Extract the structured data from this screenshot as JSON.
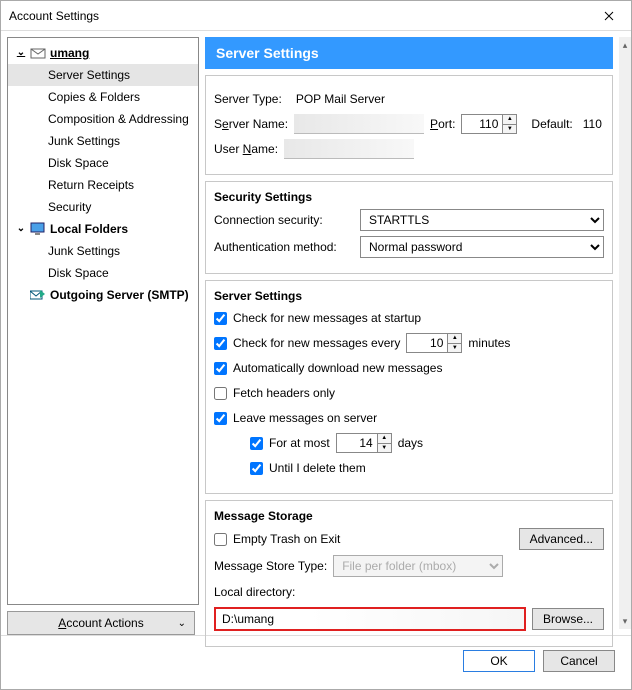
{
  "window": {
    "title": "Account Settings"
  },
  "sidebar": {
    "account_name": "umang",
    "items": [
      "Server Settings",
      "Copies & Folders",
      "Composition & Addressing",
      "Junk Settings",
      "Disk Space",
      "Return Receipts",
      "Security"
    ],
    "local_folders_label": "Local Folders",
    "local_items": [
      "Junk Settings",
      "Disk Space"
    ],
    "outgoing_label": "Outgoing Server (SMTP)",
    "account_actions": "Account Actions"
  },
  "header": {
    "title": "Server Settings"
  },
  "top": {
    "server_type_label": "Server Type:",
    "server_type_value": "POP Mail Server",
    "server_name_label_pre": "S",
    "server_name_label_under": "e",
    "server_name_label_post": "rver Name:",
    "port_label_pre": "",
    "port_label_under": "P",
    "port_label_post": "ort:",
    "port_value": "110",
    "default_label": "Default:",
    "default_value": "110",
    "user_name_label_pre": "User ",
    "user_name_label_under": "N",
    "user_name_label_post": "ame:"
  },
  "security": {
    "title": "Security Settings",
    "conn_label": "Connection security:",
    "conn_value": "STARTTLS",
    "auth_label": "Authentication method:",
    "auth_value": "Normal password"
  },
  "server": {
    "title": "Server Settings",
    "check_startup": "Check for new messages at startup",
    "check_every_pre": "Check for new messages every",
    "check_every_value": "10",
    "check_every_post": "minutes",
    "auto_download": "Automatically download new messages",
    "fetch_headers": "Fetch headers only",
    "leave_server": "Leave messages on server",
    "for_at_most_pre": "For at most",
    "for_at_most_value": "14",
    "for_at_most_post": "days",
    "until_delete": "Until I delete them"
  },
  "storage": {
    "title": "Message Storage",
    "empty_trash": "Empty Trash on Exit",
    "advanced": "Advanced...",
    "store_type_label": "Message Store Type:",
    "store_type_value": "File per folder (mbox)",
    "local_dir_label": "Local directory:",
    "local_dir_value": "D:\\umang",
    "browse": "Browse..."
  },
  "footer": {
    "ok": "OK",
    "cancel": "Cancel"
  },
  "checks": {
    "startup": true,
    "every": true,
    "auto_dl": true,
    "headers": false,
    "leave": true,
    "at_most": true,
    "until": true,
    "empty_trash": false
  }
}
